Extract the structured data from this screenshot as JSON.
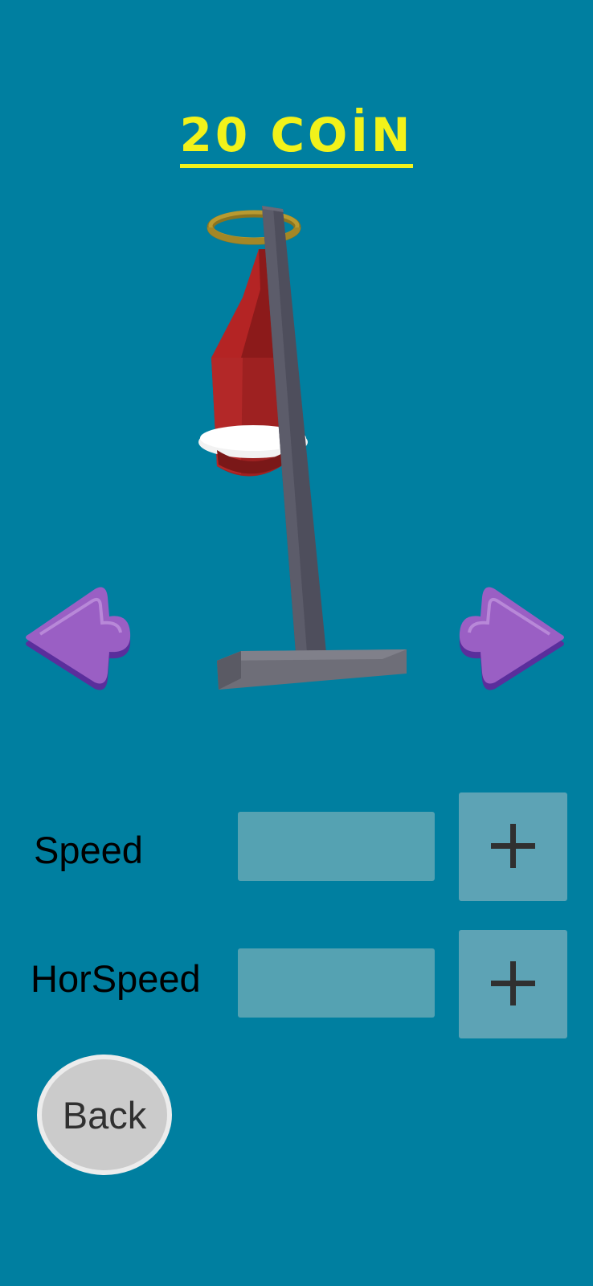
{
  "header": {
    "coin_text": "20 COİN"
  },
  "selector": {
    "prev_icon": "arrow-left-icon",
    "next_icon": "arrow-right-icon"
  },
  "stats": [
    {
      "label": "Speed",
      "upgrade_symbol": "plus"
    },
    {
      "label": "HorSpeed",
      "upgrade_symbol": "plus"
    }
  ],
  "back_button": {
    "label": "Back"
  },
  "colors": {
    "background": "#007fa0",
    "coin_text": "#f2f21a",
    "arrows": "#9a5fc4",
    "stat_bar": "#55a2b2",
    "plus_button": "#5da3b5",
    "back_button": "#cbcbcb"
  }
}
